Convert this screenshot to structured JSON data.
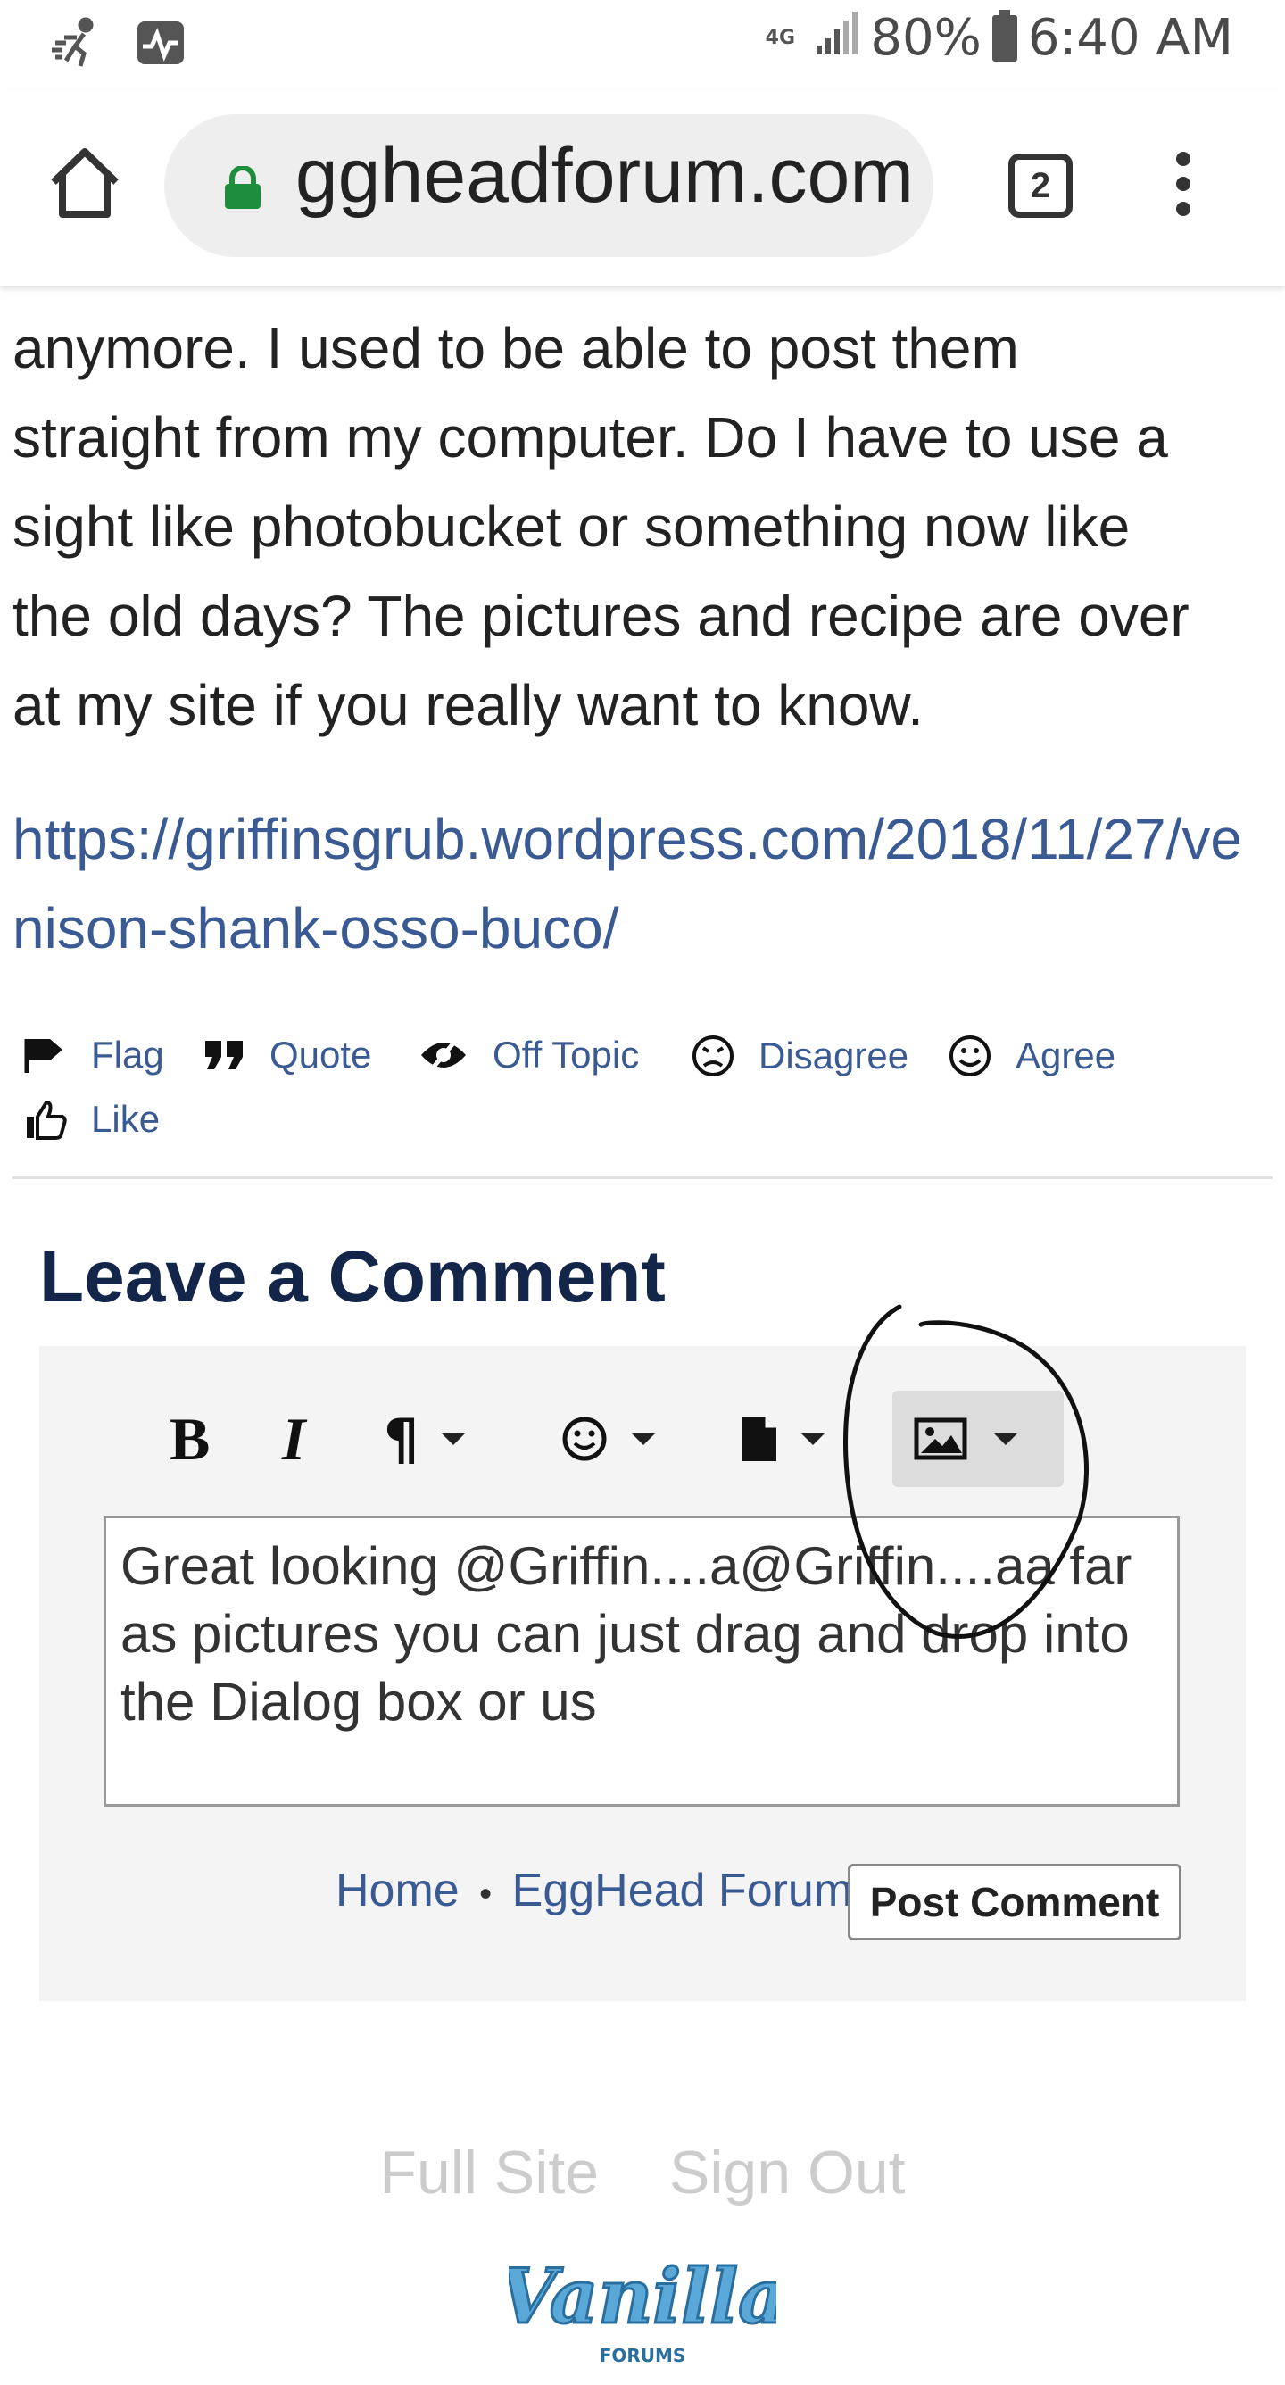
{
  "status_bar": {
    "network": "4G",
    "battery": "80%",
    "time": "6:40 AM"
  },
  "browser": {
    "url": "eggheadforum.com",
    "tab_count": "2"
  },
  "post": {
    "partial_line": "",
    "lines": [
      "anymore. I used to be able to post them",
      "straight from my computer. Do I have to use a",
      "sight like photobucket or something now like",
      "the old days? The pictures and recipe are over",
      "at my site if you really want to know."
    ],
    "link": "https://griffinsgrub.wordpress.com/2018/11/27/venison-shank-osso-buco/"
  },
  "reactions": {
    "flag": "Flag",
    "quote": "Quote",
    "off_topic": "Off Topic",
    "disagree": "Disagree",
    "agree": "Agree",
    "like": "Like"
  },
  "comment": {
    "title": "Leave a Comment",
    "text": "Great looking @Griffin....a@Griffin....aa far as pictures you can just drag and drop into the Dialog box or us",
    "home_link": "Home",
    "separator": "•",
    "forum_link": "EggHead Forum",
    "post_button": "Post Comment"
  },
  "footer": {
    "full_site": "Full Site",
    "sign_out": "Sign Out",
    "logo_text": "Vanilla",
    "logo_sub": "FORUMS"
  },
  "colors": {
    "link": "#3a5a94",
    "heading": "#14254a",
    "panel": "#f4f4f4",
    "lock": "#1e8e3e"
  }
}
